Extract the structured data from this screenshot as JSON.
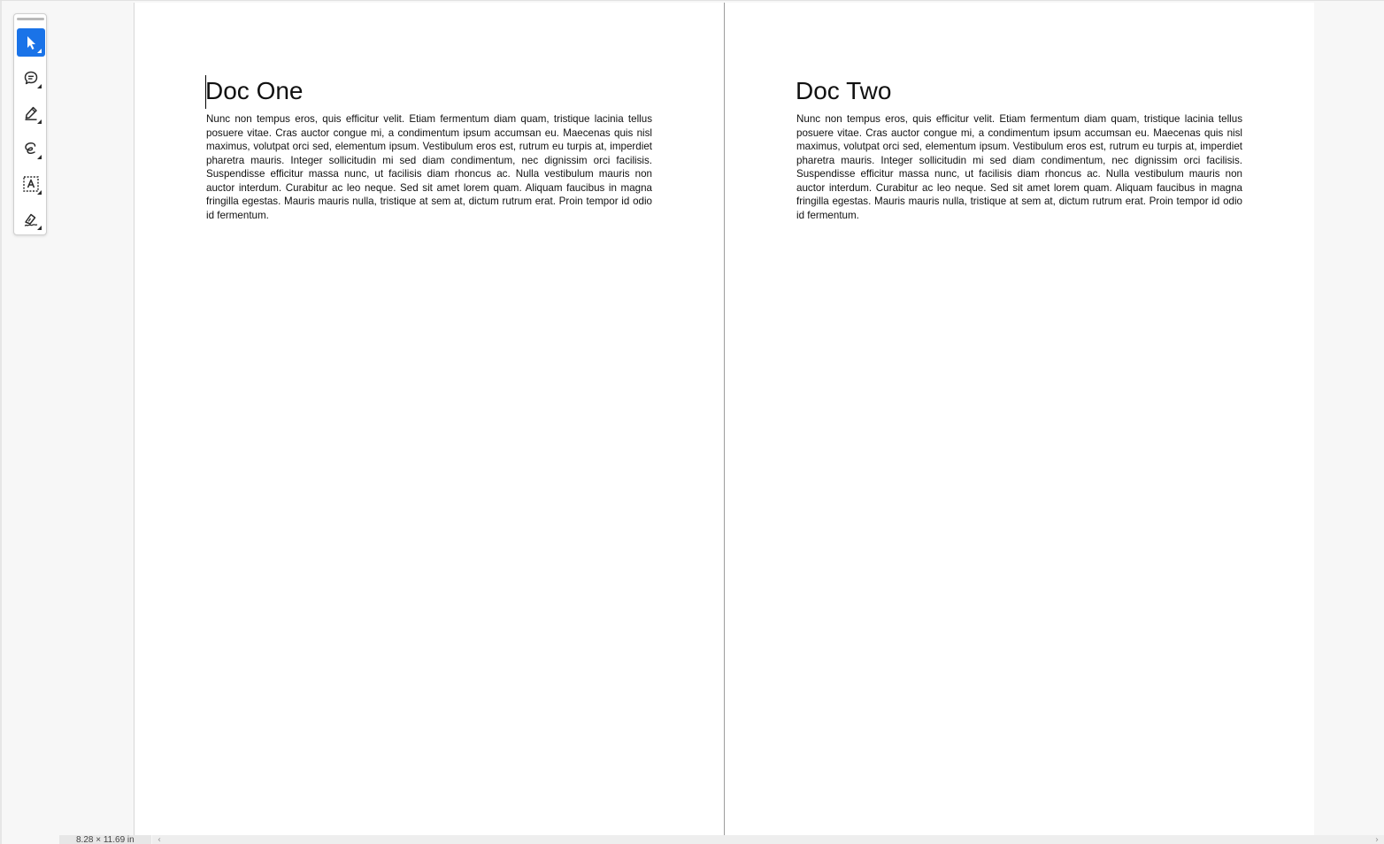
{
  "toolbar": {
    "tools": [
      {
        "name": "select",
        "icon": "pointer-arrow-icon",
        "active": true
      },
      {
        "name": "comment",
        "icon": "comment-bubble-icon",
        "active": false
      },
      {
        "name": "highlight",
        "icon": "highlighter-pen-icon",
        "active": false
      },
      {
        "name": "freehand",
        "icon": "lasso-draw-icon",
        "active": false
      },
      {
        "name": "text-box",
        "icon": "text-box-icon",
        "active": false
      },
      {
        "name": "signature",
        "icon": "signature-pen-icon",
        "active": false
      }
    ],
    "accent_color": "#1a73e8"
  },
  "pages": [
    {
      "title": "Doc One",
      "body": "Nunc non tempus eros, quis efficitur velit. Etiam fermentum diam quam, tristique lacinia tellus posuere vitae. Cras auctor congue mi, a condimentum ipsum accumsan eu. Maecenas quis nisl maximus, volutpat orci sed, elementum ipsum. Vestibulum eros est, rutrum eu turpis at, imperdiet pharetra mauris. Integer sollicitudin mi sed diam condimentum, nec dignissim orci facilisis. Suspendisse efficitur massa nunc, ut facilisis diam rhoncus ac. Nulla vestibulum mauris non auctor interdum. Curabitur ac leo neque. Sed sit amet lorem quam. Aliquam faucibus in magna fringilla egestas. Mauris mauris nulla, tristique at sem at, dictum rutrum erat. Proin tempor id odio id fermentum."
    },
    {
      "title": "Doc Two",
      "body": "Nunc non tempus eros, quis efficitur velit. Etiam fermentum diam quam, tristique lacinia tellus posuere vitae. Cras auctor congue mi, a condimentum ipsum accumsan eu. Maecenas quis nisl maximus, volutpat orci sed, elementum ipsum. Vestibulum eros est, rutrum eu turpis at, imperdiet pharetra mauris. Integer sollicitudin mi sed diam condimentum, nec dignissim orci facilisis. Suspendisse efficitur massa nunc, ut facilisis diam rhoncus ac. Nulla vestibulum mauris non auctor interdum. Curabitur ac leo neque. Sed sit amet lorem quam. Aliquam faucibus in magna fringilla egestas. Mauris mauris nulla, tristique at sem at, dictum rutrum erat. Proin tempor id odio id fermentum."
    }
  ],
  "status": {
    "page_size": "8.28 × 11.69 in"
  },
  "scrollbar": {
    "left_arrow": "‹",
    "right_arrow": "›"
  }
}
